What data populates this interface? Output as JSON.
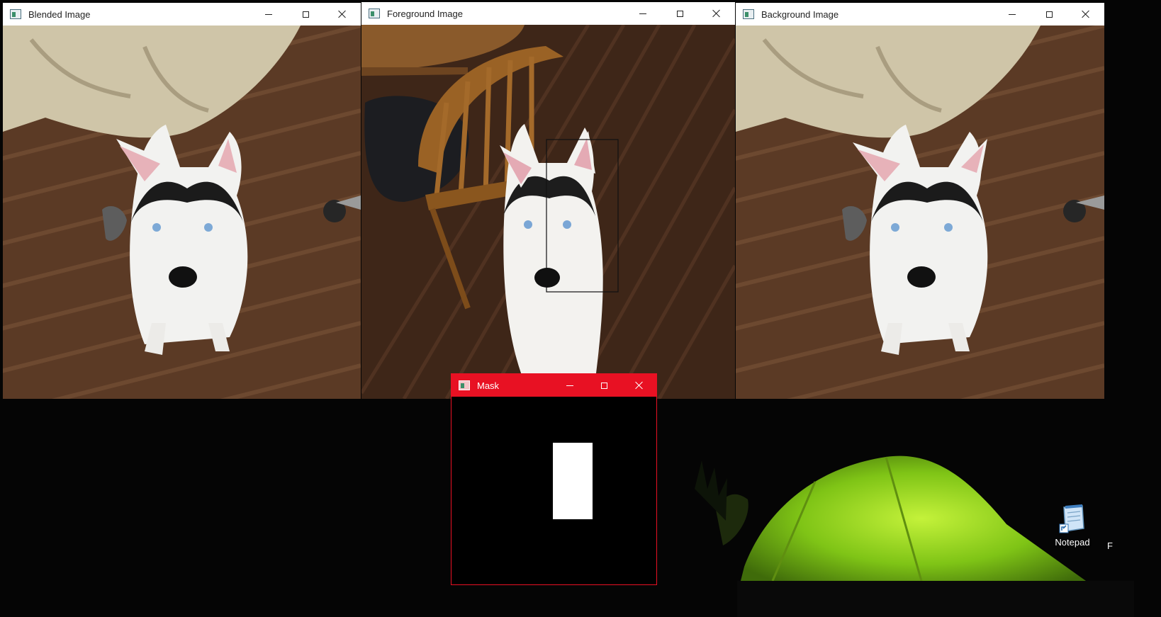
{
  "windows": {
    "blended": {
      "title": "Blended Image"
    },
    "foreground": {
      "title": "Foreground Image"
    },
    "background": {
      "title": "Background Image"
    },
    "mask": {
      "title": "Mask"
    }
  },
  "desktop": {
    "notepad_label": "Notepad",
    "edge_label": "F"
  },
  "colors": {
    "mask_accent": "#e81123",
    "tent_green": "#8fd61c",
    "floor_brown": "#5a3a26"
  },
  "icons": {
    "minimize": "minimize-icon",
    "maximize": "maximize-icon",
    "close": "close-icon",
    "app": "app-window-icon",
    "notepad": "notepad-icon"
  }
}
